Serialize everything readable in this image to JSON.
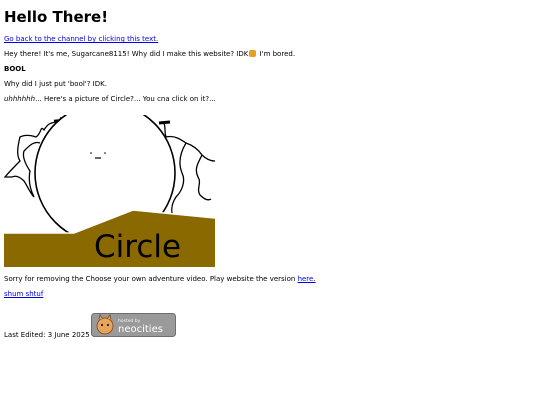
{
  "header": {
    "title": "Hello There!"
  },
  "links": {
    "back_to_channel": "Go back to the channel by clicking this text."
  },
  "intro": {
    "before_emoji": "Hey there! It's me, Sugarcane8115! Why did I make this website? IDK",
    "after_emoji": " I'm bored."
  },
  "bool": {
    "heading": "BOOL",
    "question": "Why did I just put 'bool'? IDK."
  },
  "circle": {
    "caption": "uhhhhhh... Here's a picture of Circle?... You cna click on it?...",
    "image_text": "Circle"
  },
  "notice": {
    "text": "Sorry for removing the Choose your own adventure video. Play website the version ",
    "link": "here."
  },
  "extra_link": "shum shtuf",
  "footer": {
    "last_edited": "Last Edited: 3 June 2025",
    "badge_small": "hosted by",
    "badge_big": "neocities"
  },
  "colors": {
    "link": "#0000ee",
    "ground": "#8a6a00",
    "badge_bg": "#9a9a9a"
  }
}
